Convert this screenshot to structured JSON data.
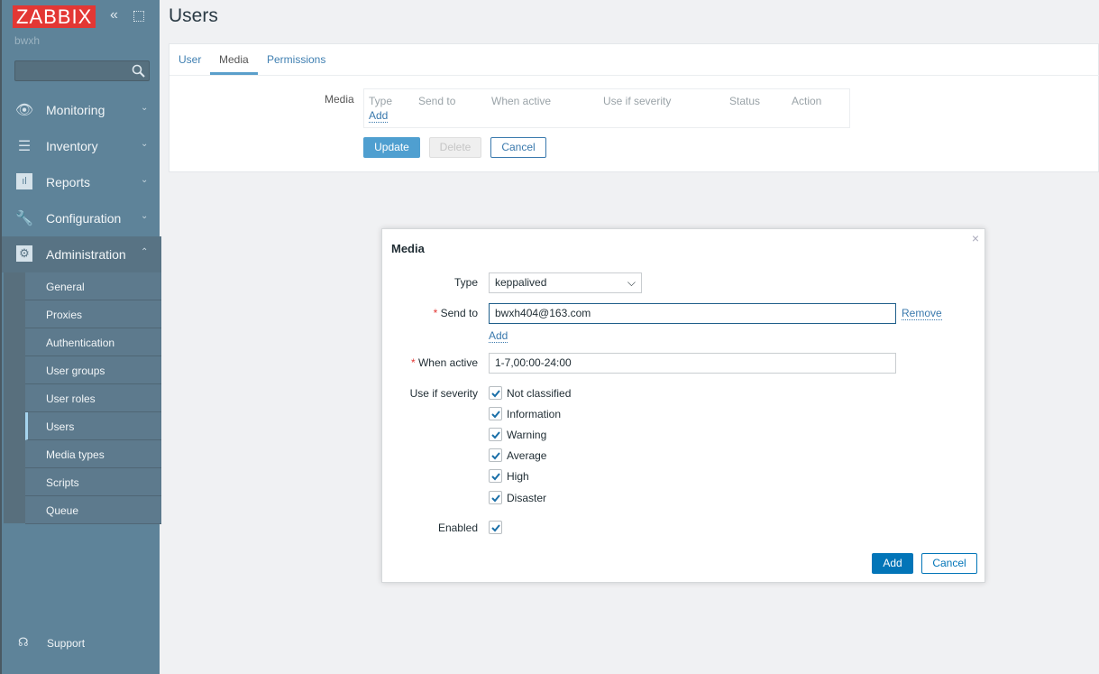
{
  "sidebar": {
    "logo": "ZABBIX",
    "user": "bwxh",
    "search_placeholder": "",
    "menu": [
      {
        "label": "Monitoring",
        "icon": "eye-icon"
      },
      {
        "label": "Inventory",
        "icon": "list-icon"
      },
      {
        "label": "Reports",
        "icon": "bar-chart-icon"
      },
      {
        "label": "Configuration",
        "icon": "wrench-icon"
      },
      {
        "label": "Administration",
        "icon": "gear-icon"
      }
    ],
    "submenu": [
      "General",
      "Proxies",
      "Authentication",
      "User groups",
      "User roles",
      "Users",
      "Media types",
      "Scripts",
      "Queue"
    ],
    "selected": "Users",
    "support": "Support"
  },
  "page": {
    "title": "Users",
    "tabs": [
      "User",
      "Media",
      "Permissions"
    ],
    "active_tab": "Media",
    "media_label": "Media",
    "media_columns": [
      "Type",
      "Send to",
      "When active",
      "Use if severity",
      "Status",
      "Action"
    ],
    "add_link": "Add",
    "buttons": {
      "update": "Update",
      "delete": "Delete",
      "cancel": "Cancel"
    }
  },
  "modal": {
    "title": "Media",
    "type_label": "Type",
    "type_value": "keppalived",
    "send_to_label": "Send to",
    "send_to_value": "bwxh404@163.com",
    "remove": "Remove",
    "add_link": "Add",
    "when_active_label": "When active",
    "when_active_value": "1-7,00:00-24:00",
    "severity_label": "Use if severity",
    "severities": [
      {
        "label": "Not classified",
        "checked": true
      },
      {
        "label": "Information",
        "checked": true
      },
      {
        "label": "Warning",
        "checked": true
      },
      {
        "label": "Average",
        "checked": true
      },
      {
        "label": "High",
        "checked": true
      },
      {
        "label": "Disaster",
        "checked": true
      }
    ],
    "enabled_label": "Enabled",
    "enabled": true,
    "add_button": "Add",
    "cancel_button": "Cancel",
    "required_mark": "*"
  },
  "colors": {
    "sidebar": "#5e8399",
    "accent": "#0275b8",
    "logo": "#e33734"
  }
}
